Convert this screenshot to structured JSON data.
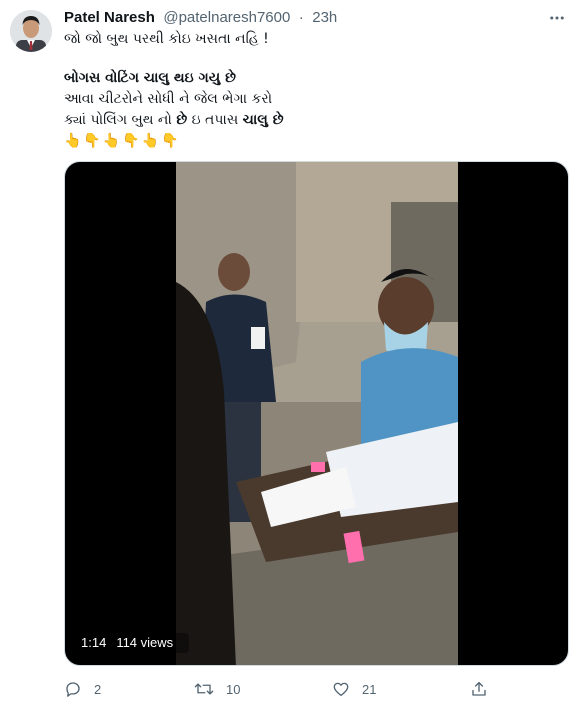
{
  "tweet": {
    "author_name": "Patel Naresh",
    "handle": "@patelnaresh7600",
    "separator": "·",
    "time": "23h",
    "line1": "જો જો બુથ પરથી કોઇ ખસતા નહિ !",
    "line2": "બોગસ વોટિંગ ચાલુ થઇ ગયુ છે",
    "line3": "આવા ચીટરોને સોધી ને જેલ ભેગા કરો",
    "line4_part1": "ક્યાં પોલિંગ બુથ નો ",
    "line4_bold1": "છે",
    "line4_part2": " ઇ તપાસ ",
    "line4_bold2": "ચાલુ છે",
    "emoji_row": "👆👇👆👇👆👇"
  },
  "video": {
    "duration": "1:14",
    "views": "114 views"
  },
  "actions": {
    "replies": "2",
    "retweets": "10",
    "likes": "21"
  },
  "colors": {
    "text": "#0f1419",
    "secondary": "#536471",
    "media_bg": "#000000"
  },
  "icons": [
    "more-icon",
    "reply-icon",
    "retweet-icon",
    "like-icon",
    "share-icon"
  ]
}
